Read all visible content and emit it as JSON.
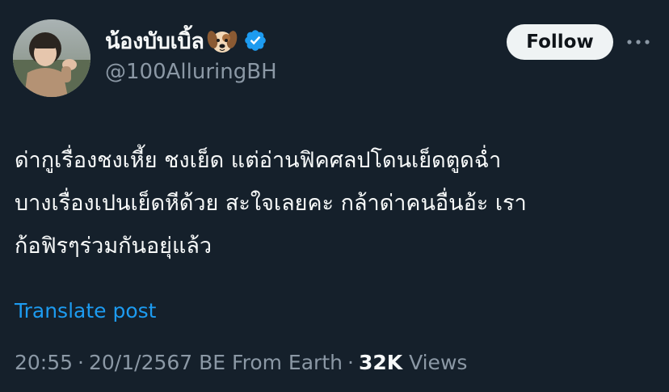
{
  "author": {
    "display_name": "น้องบับเบิ้ล",
    "emoji_icon": "dog-face-icon",
    "verified_icon": "verified-badge-icon",
    "handle": "@100AlluringBH"
  },
  "actions": {
    "follow_label": "Follow",
    "more_icon": "more-horizontal-icon"
  },
  "tweet": {
    "lines": [
      "ด่ากูเรื่องชงเหี้ย ชงเย็ด แต่อ่านฟิคศลปโดนเย็ดตูดฉ่ำ",
      "บางเรื่องเปนเย็ดหีด้วย สะใจเลยคะ กล้าด่าคนอื่นอ้ะ เรา",
      "ก้อฟิรๆร่วมกันอยุ่แล้ว"
    ],
    "translate_label": "Translate post"
  },
  "meta": {
    "time": "20:55",
    "date": "20/1/2567 BE",
    "source": "From Earth",
    "views_count": "32K",
    "views_label": "Views",
    "separator": "·"
  },
  "colors": {
    "background": "#15202b",
    "text": "#f7f9f9",
    "secondary": "#8b98a5",
    "link": "#1d9bf0",
    "follow_bg": "#eff3f4",
    "verified": "#1d9bf0"
  }
}
